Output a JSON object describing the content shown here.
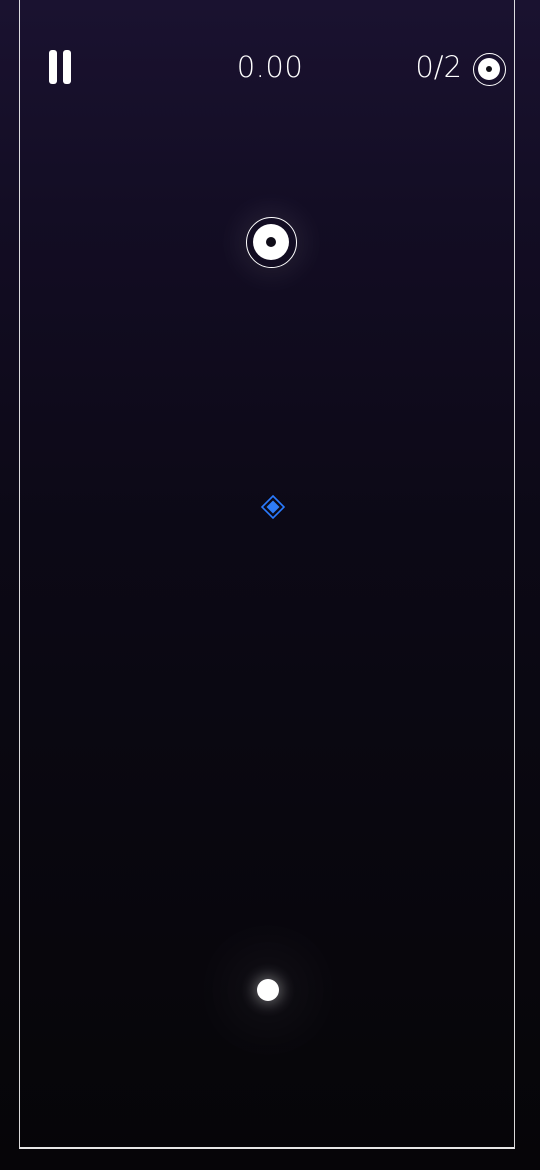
{
  "hud": {
    "pause_icon": "pause-icon",
    "timer": "0.00",
    "targets_progress": "0/2",
    "target_icon": "ring-target-icon"
  },
  "field": {
    "target_icon": "ring-target-icon",
    "pickup_icon": "diamond-icon",
    "ball_icon": "ball-icon"
  },
  "colors": {
    "background_top": "#1a1230",
    "background_bottom": "#060508",
    "border": "#ffffff",
    "diamond": "#2a7bff",
    "target": "#ffffff",
    "ball": "#ffffff"
  }
}
